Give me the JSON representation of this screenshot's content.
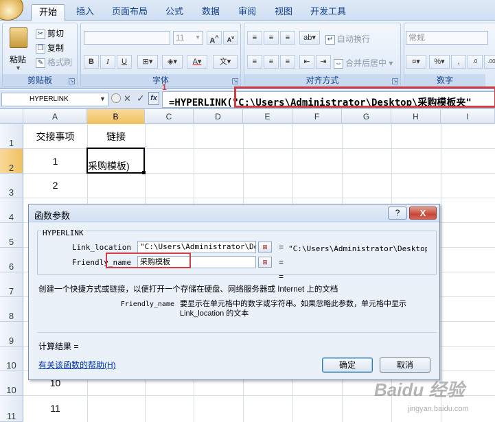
{
  "tabs": [
    "开始",
    "插入",
    "页面布局",
    "公式",
    "数据",
    "审阅",
    "视图",
    "开发工具"
  ],
  "ribbon": {
    "clipboard": {
      "paste": "粘贴",
      "cut": "剪切",
      "copy": "复制",
      "format_painter": "格式刷",
      "title": "剪贴板"
    },
    "font": {
      "size": "11",
      "title": "字体"
    },
    "alignment": {
      "wrap": "自动换行",
      "merge": "合并后居中",
      "title": "对齐方式"
    },
    "number": {
      "format": "常规",
      "title": "数字"
    }
  },
  "annotation_marker": "1",
  "formula_bar": {
    "name_box": "HYPERLINK",
    "formula": "=HYPERLINK(\"C:\\Users\\Administrator\\Desktop\\采购模板夹\""
  },
  "columns": [
    "A",
    "B",
    "C",
    "D",
    "E",
    "F",
    "G",
    "H",
    "I"
  ],
  "rows": [
    "1",
    "2",
    "3",
    "4",
    "5",
    "6",
    "7",
    "8",
    "9",
    "10",
    "10",
    "11"
  ],
  "cells": {
    "A1": "交接事项",
    "B1": "链接",
    "A2": "1",
    "B2": "采购模板)",
    "A3": "2",
    "A_row11": "10",
    "A_row12": "11"
  },
  "dialog": {
    "title": "函数参数",
    "help_btn": "?",
    "close_btn": "X",
    "function_name": "HYPERLINK",
    "args": [
      {
        "label": "Link_location",
        "value": "\"C:\\Users\\Administrator\\Desk",
        "result": "\"C:\\Users\\Administrator\\Desktop\\采"
      },
      {
        "label": "Friendly_name",
        "value": "采购模板",
        "result": ""
      }
    ],
    "eq": "=",
    "description": "创建一个快捷方式或链接，以便打开一个存储在硬盘、网络服务器或  Internet 上的文档",
    "arg_desc_name": "Friendly_name",
    "arg_desc": "要显示在单元格中的数字或字符串。如果忽略此参数，单元格中显示 Link_location 的文本",
    "result_label": "计算结果 =",
    "help_link": "有关该函数的帮助(H)",
    "ok": "确定",
    "cancel": "取消"
  },
  "watermark": "Baidu 经验",
  "watermark_url": "jingyan.baidu.com",
  "colors": {
    "accent": "#15428b",
    "annotation_red": "#d33c43",
    "selected_header": "#f1c15f"
  }
}
